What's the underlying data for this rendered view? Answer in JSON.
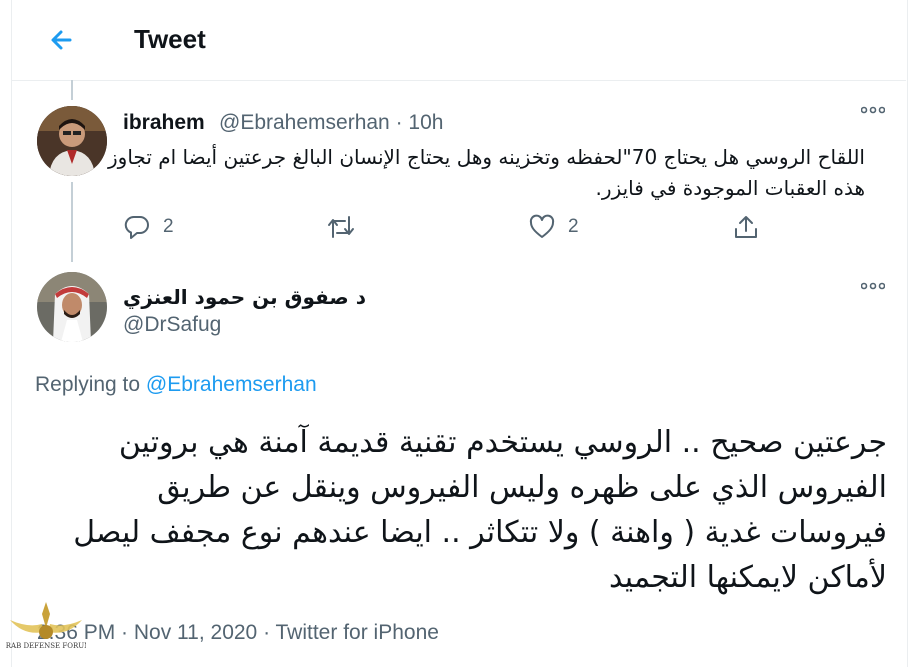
{
  "header": {
    "title": "Tweet",
    "back_label": "Back"
  },
  "parent_tweet": {
    "author_name": "ibrahem",
    "author_handle": "@Ebrahemserhan · 10h",
    "text": "اللقاح الروسي هل يحتاج 70\"لحفظه وتخزينه وهل يحتاج الإنسان البالغ جرعتين أيضا ام تجاوز هذه العقبات الموجودة في فايزر.",
    "reply_count": "2",
    "like_count": "2"
  },
  "main_tweet": {
    "author_name": "د صفوق بن حمود العنزي",
    "author_handle": "@DrSafug",
    "replying_prefix": "Replying to ",
    "replying_to": "@Ebrahemserhan",
    "text": "جرعتين صحيح .. الروسي يستخدم تقنية قديمة آمنة هي بروتين الفيروس الذي على ظهره وليس الفيروس وينقل عن طريق فيروسات غدية ( واهنة ) ولا تتكاثر .. ايضا عندهم نوع مجفف ليصل لأماكن لايمكنها التجميد",
    "meta": "2:36 PM · Nov 11, 2020 · Twitter for iPhone"
  },
  "watermark": {
    "text": "ARAB DEFENSE FORUM"
  },
  "colors": {
    "accent": "#1d9bf0",
    "muted": "#536471",
    "text": "#0f1419",
    "border": "#ebeef0"
  },
  "icons": [
    "back-arrow-icon",
    "more-dots-icon",
    "reply-icon",
    "retweet-icon",
    "like-icon",
    "share-icon"
  ]
}
